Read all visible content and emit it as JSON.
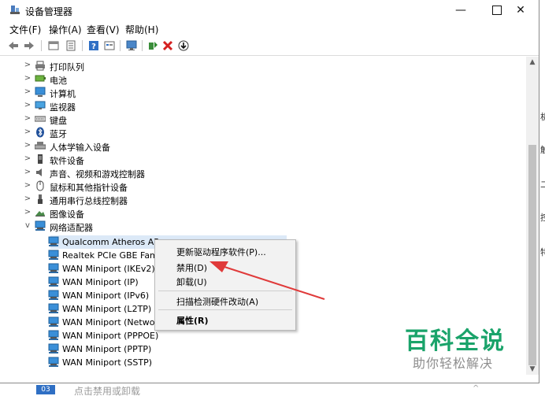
{
  "window": {
    "title": "设备管理器"
  },
  "menubar": [
    {
      "label": "文件(F)"
    },
    {
      "label": "操作(A)"
    },
    {
      "label": "查看(V)"
    },
    {
      "label": "帮助(H)"
    }
  ],
  "toolbar": {
    "icons": [
      "back-icon",
      "forward-icon",
      "properties-view-icon",
      "list-view-icon",
      "help-icon",
      "properties-icon",
      "monitor-scan-icon",
      "update-driver-icon",
      "uninstall-icon",
      "download-icon"
    ]
  },
  "tree": {
    "categories": [
      {
        "label": "打印队列",
        "icon": "printer-icon",
        "expanded": false
      },
      {
        "label": "电池",
        "icon": "battery-icon",
        "expanded": false
      },
      {
        "label": "计算机",
        "icon": "computer-icon",
        "expanded": false
      },
      {
        "label": "监视器",
        "icon": "monitor-icon",
        "expanded": false
      },
      {
        "label": "键盘",
        "icon": "keyboard-icon",
        "expanded": false
      },
      {
        "label": "蓝牙",
        "icon": "bluetooth-icon",
        "expanded": false
      },
      {
        "label": "人体学输入设备",
        "icon": "hid-icon",
        "expanded": false
      },
      {
        "label": "软件设备",
        "icon": "software-device-icon",
        "expanded": false
      },
      {
        "label": "声音、视频和游戏控制器",
        "icon": "speaker-icon",
        "expanded": false
      },
      {
        "label": "鼠标和其他指针设备",
        "icon": "mouse-icon",
        "expanded": false
      },
      {
        "label": "通用串行总线控制器",
        "icon": "usb-icon",
        "expanded": false
      },
      {
        "label": "图像设备",
        "icon": "camera-icon",
        "expanded": false
      },
      {
        "label": "网络适配器",
        "icon": "network-adapter-icon",
        "expanded": true
      }
    ],
    "network_adapters": [
      {
        "label": "Qualcomm Atheros AR",
        "selected": true
      },
      {
        "label": "Realtek PCIe GBE Fami",
        "selected": false
      },
      {
        "label": "WAN Miniport (IKEv2)",
        "selected": false
      },
      {
        "label": "WAN Miniport (IP)",
        "selected": false
      },
      {
        "label": "WAN Miniport (IPv6)",
        "selected": false
      },
      {
        "label": "WAN Miniport (L2TP)",
        "selected": false
      },
      {
        "label": "WAN Miniport (Netwo",
        "selected": false
      },
      {
        "label": "WAN Miniport (PPPOE)",
        "selected": false
      },
      {
        "label": "WAN Miniport (PPTP)",
        "selected": false
      },
      {
        "label": "WAN Miniport (SSTP)",
        "selected": false
      }
    ]
  },
  "context_menu": {
    "update_driver": "更新驱动程序软件(P)...",
    "disable": "禁用(D)",
    "uninstall": "卸载(U)",
    "scan": "扫描检测硬件改动(A)",
    "properties": "属性(R)"
  },
  "watermark": {
    "title": "百科全说",
    "subtitle": "助你轻松解决"
  },
  "bottom": {
    "badge": "03",
    "text": "点击禁用或卸载"
  },
  "colors": {
    "accent": "#2f6fc4",
    "selection": "#dce9f7",
    "watermark_green": "#1aa36a",
    "arrow_red": "#e03a3a"
  }
}
